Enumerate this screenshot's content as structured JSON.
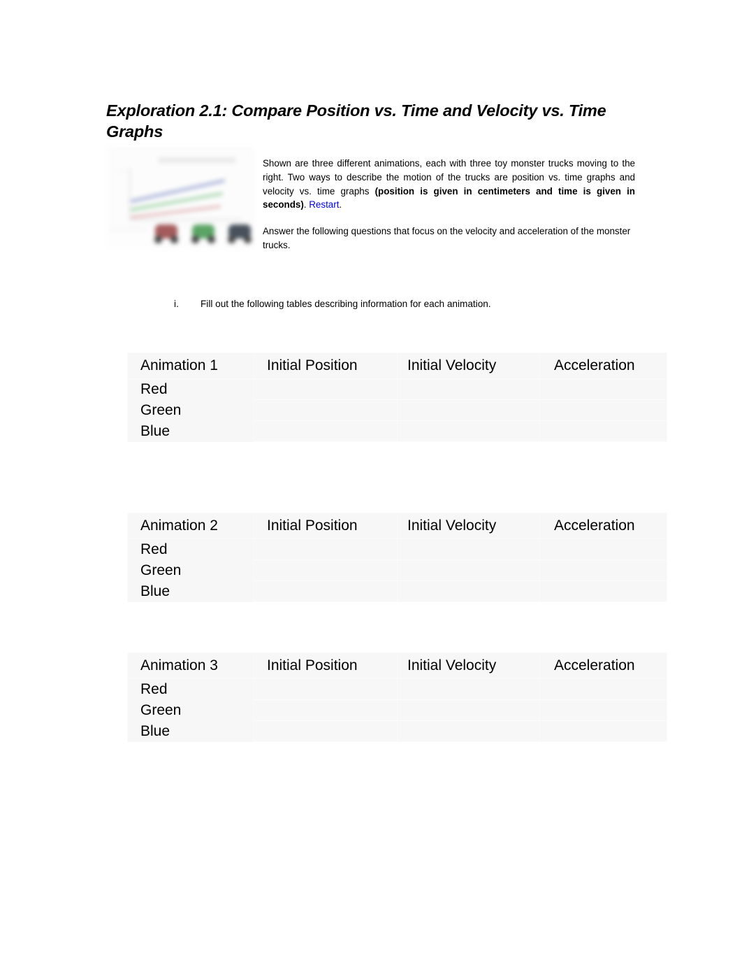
{
  "document": {
    "title": "Exploration 2.1: Compare Position vs. Time and Velocity vs. Time Graphs"
  },
  "intro": {
    "paragraph_1_part_1": "Shown are three different animations, each with three toy monster trucks moving to the right.  Two ways to describe the motion of the trucks are position vs. time graphs and velocity vs. time graphs ",
    "paragraph_1_bold": "(position is given in centimeters and time is given in seconds)",
    "paragraph_1_part_2": ". ",
    "restart_link": "Restart",
    "paragraph_1_end": ".",
    "paragraph_2": "Answer the following questions that focus on the velocity and acceleration of the monster trucks."
  },
  "question": {
    "marker": "i.",
    "text": "Fill out the following tables describing information for each animation."
  },
  "thumbnail": {
    "alt": "animation-preview",
    "truck_colors": [
      "#9e4f4f",
      "#4f9e5b",
      "#3b4450"
    ],
    "line_colors": [
      "#9aa6d4",
      "#9ed3a6",
      "#e4b9b9"
    ]
  },
  "colors": {
    "link": "#0000ee",
    "table_background": "#f7f7f7",
    "table_border": "#fbfbfb",
    "text": "#000000",
    "page_background": "#ffffff"
  },
  "tables": [
    {
      "headers": [
        "Animation 1",
        "Initial Position",
        "Initial Velocity",
        "Acceleration"
      ],
      "rows": [
        {
          "label": "Red",
          "initial_position": "",
          "initial_velocity": "",
          "acceleration": ""
        },
        {
          "label": "Green",
          "initial_position": "",
          "initial_velocity": "",
          "acceleration": ""
        },
        {
          "label": "Blue",
          "initial_position": "",
          "initial_velocity": "",
          "acceleration": ""
        }
      ]
    },
    {
      "headers": [
        "Animation 2",
        "Initial Position",
        "Initial Velocity",
        "Acceleration"
      ],
      "rows": [
        {
          "label": "Red",
          "initial_position": "",
          "initial_velocity": "",
          "acceleration": ""
        },
        {
          "label": "Green",
          "initial_position": "",
          "initial_velocity": "",
          "acceleration": ""
        },
        {
          "label": "Blue",
          "initial_position": "",
          "initial_velocity": "",
          "acceleration": ""
        }
      ]
    },
    {
      "headers": [
        "Animation 3",
        "Initial Position",
        "Initial Velocity",
        "Acceleration"
      ],
      "rows": [
        {
          "label": "Red",
          "initial_position": "",
          "initial_velocity": "",
          "acceleration": ""
        },
        {
          "label": "Green",
          "initial_position": "",
          "initial_velocity": "",
          "acceleration": ""
        },
        {
          "label": "Blue",
          "initial_position": "",
          "initial_velocity": "",
          "acceleration": ""
        }
      ]
    }
  ]
}
